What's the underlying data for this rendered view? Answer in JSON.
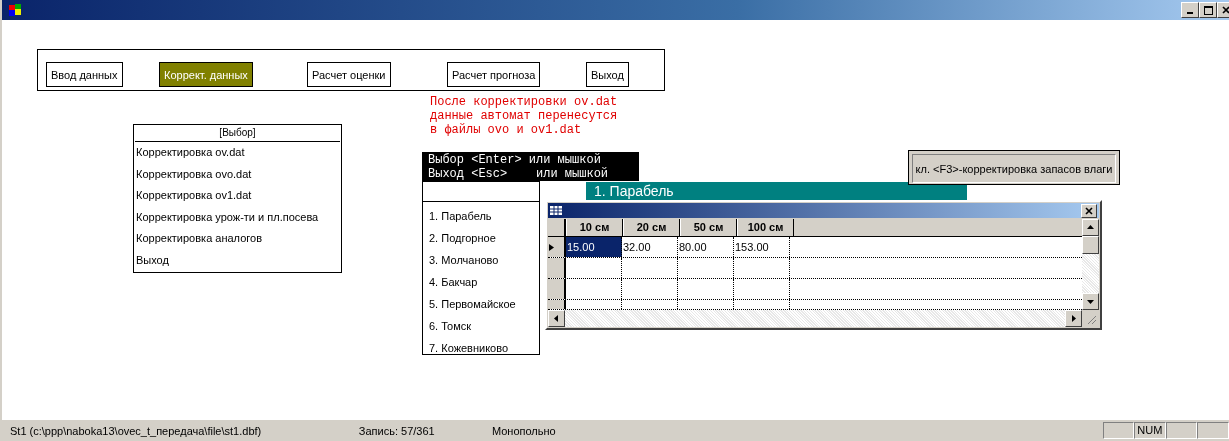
{
  "toolbar": {
    "buttons": [
      {
        "label": "Ввод данных",
        "selected": false
      },
      {
        "label": "Коррект. данных",
        "selected": true
      },
      {
        "label": "Расчет оценки",
        "selected": false
      },
      {
        "label": "Расчет прогноза",
        "selected": false
      },
      {
        "label": "Выход",
        "selected": false
      }
    ]
  },
  "note": [
    "После корректировки ov.dat",
    "данные автомат перенесутся",
    "в файлы ovo и ov1.dat"
  ],
  "menu": {
    "title": "[Выбор]",
    "items": [
      "Корректировка ov.dat",
      "Корректировка ovo.dat",
      "Корректировка ov1.dat",
      "Корректировка урож-ти и пл.посева",
      "Корректировка аналогов",
      "Выход"
    ]
  },
  "hint": [
    "Выбор <Enter> или мышкой",
    "Выход <Esc>    или мышкой"
  ],
  "stations": [
    "1. Парабель",
    "2. Подгорное",
    "3. Молчаново",
    "4. Бакчар",
    "5. Первомайское",
    "6. Томск",
    "7. Кожевниково"
  ],
  "station_banner": "1. Парабель",
  "f3_hint": "кл. <F3>-корректировка запасов влаги",
  "grid": {
    "columns": [
      "10 см",
      "20 см",
      "50 см",
      "100 см"
    ],
    "rows": [
      {
        "current": true,
        "cells": [
          {
            "text": "15.00",
            "selected": true
          },
          {
            "text": "32.00",
            "selected": false
          },
          {
            "text": "80.00",
            "selected": false
          },
          {
            "text": "153.00",
            "selected": false
          }
        ]
      }
    ]
  },
  "status_bar": {
    "file": "St1 (c:\\ppp\\naboka13\\ovec_t_передача\\file\\st1.dbf)",
    "record": "Запись: 57/361",
    "mode": "Монопольно",
    "indicators": [
      {
        "text": "NUM"
      }
    ]
  }
}
